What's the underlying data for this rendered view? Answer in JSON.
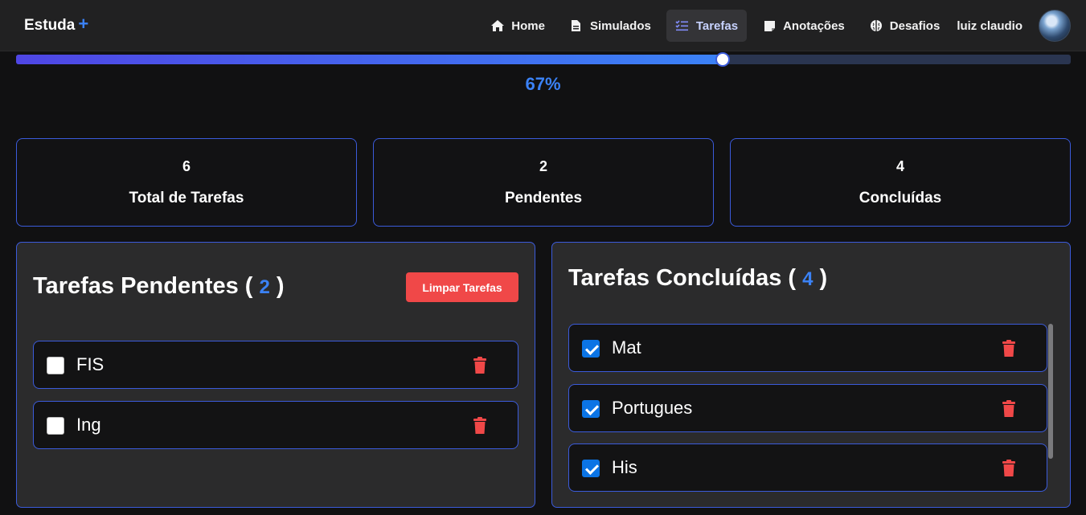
{
  "brand": {
    "name": "Estuda",
    "plus": "+"
  },
  "nav": {
    "items": [
      {
        "label": "Home",
        "icon": "home-icon",
        "active": false
      },
      {
        "label": "Simulados",
        "icon": "document-icon",
        "active": false
      },
      {
        "label": "Tarefas",
        "icon": "checklist-icon",
        "active": true
      },
      {
        "label": "Anotações",
        "icon": "note-icon",
        "active": false
      },
      {
        "label": "Desafios",
        "icon": "brain-icon",
        "active": false
      }
    ],
    "user": "luiz claudio"
  },
  "progress": {
    "value": 0.67,
    "label": "67%"
  },
  "stats": [
    {
      "value": "6",
      "label": "Total de Tarefas"
    },
    {
      "value": "2",
      "label": "Pendentes"
    },
    {
      "value": "4",
      "label": "Concluídas"
    }
  ],
  "pending": {
    "title": "Tarefas Pendentes (",
    "count": "2",
    "close": ")",
    "clear_label": "Limpar Tarefas",
    "tasks": [
      {
        "name": "FIS",
        "done": false
      },
      {
        "name": "Ing",
        "done": false
      }
    ]
  },
  "done": {
    "title": "Tarefas Concluídas (",
    "count": "4",
    "close": ")",
    "tasks": [
      {
        "name": "Mat",
        "done": true
      },
      {
        "name": "Portugues",
        "done": true
      },
      {
        "name": "His",
        "done": true
      }
    ]
  },
  "colors": {
    "accent": "#3b82f6",
    "border": "#3b5bdb",
    "danger": "#f04848"
  }
}
